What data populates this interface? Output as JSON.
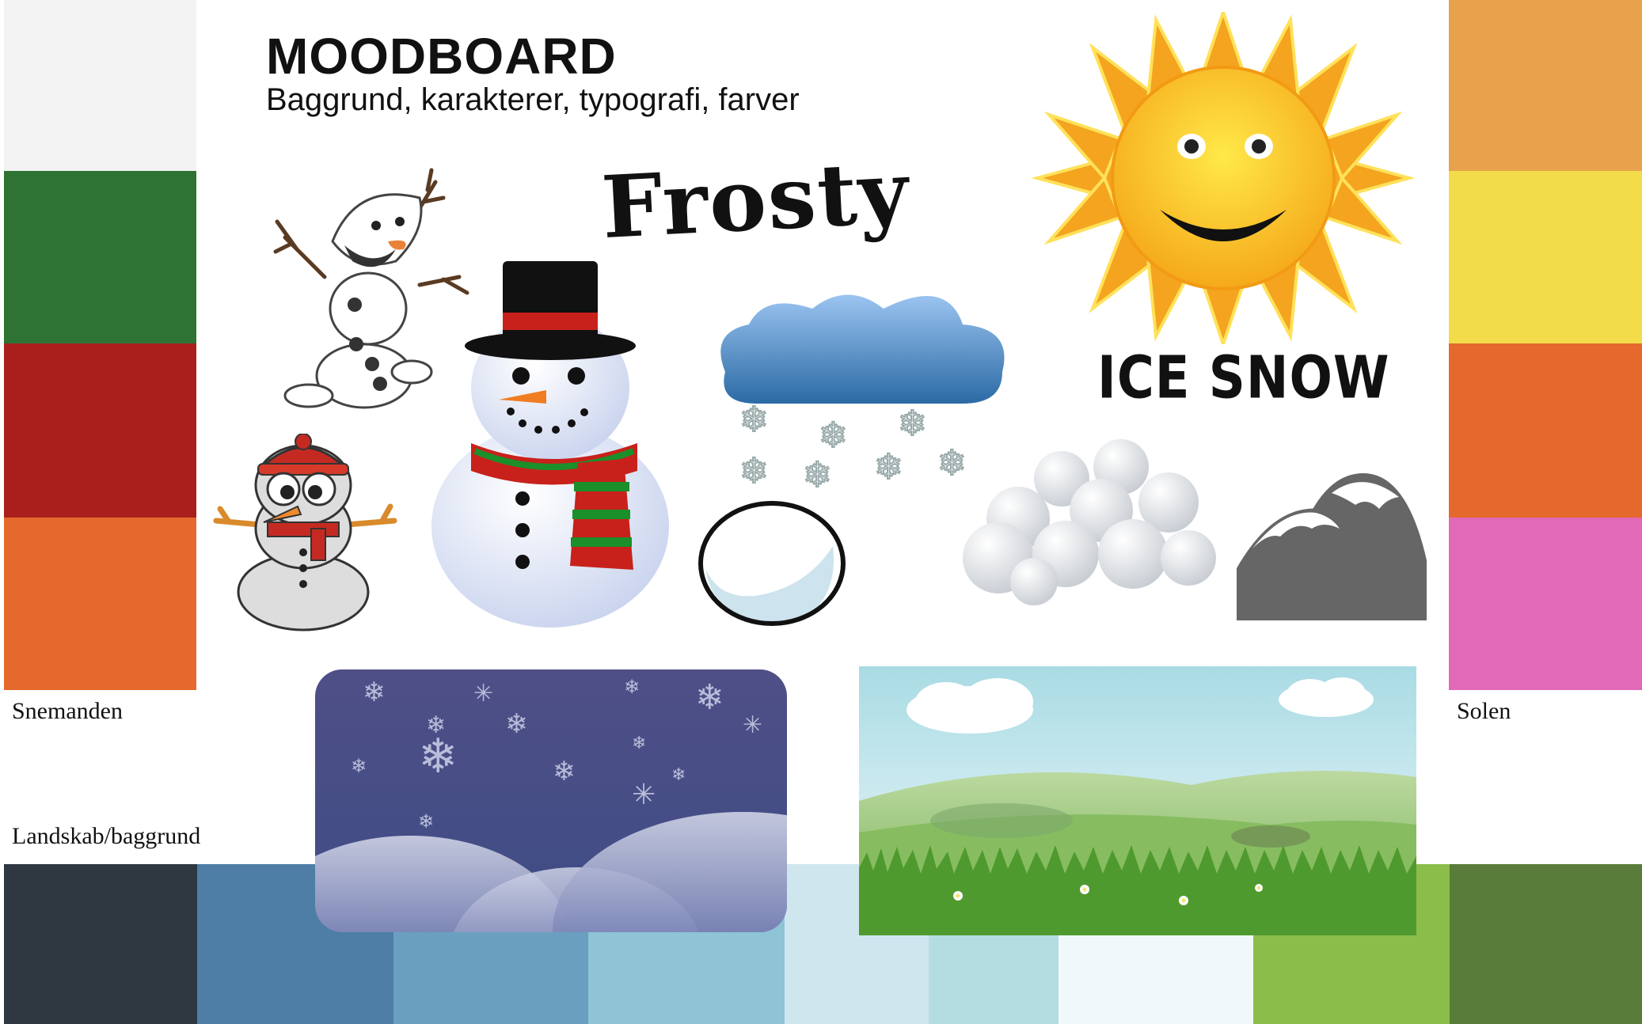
{
  "header": {
    "title": "MOODBOARD",
    "subtitle": "Baggrund, karakterer, typografi, farver"
  },
  "labels": {
    "snowman": "Snemanden",
    "sun": "Solen",
    "landscape": "Landskab/baggrund"
  },
  "typography_samples": {
    "frosty": "Frosty",
    "ice_snow": "ICE SNOW"
  },
  "palettes": {
    "snowman": [
      "#f3f3f3",
      "#2e7334",
      "#aa1f1b",
      "#e5692d"
    ],
    "sun": [
      "#e8a24c",
      "#f2dc4a",
      "#e5692d",
      "#e269b8"
    ],
    "landscape": [
      "#2f3740",
      "#4e7ea5",
      "#6a9fc0",
      "#8fc3d6",
      "#cfe6ef",
      "#b4dde1",
      "#f1f8f9",
      "#8bbd4a",
      "#5a7c3a"
    ]
  },
  "icons": [
    "olaf-snowman-icon",
    "cartoon-snowman-icon",
    "top-hat-snowman-icon",
    "snow-cloud-icon",
    "snowball-icon",
    "snowball-pile-icon",
    "snowy-mountain-icon",
    "smiling-sun-icon"
  ],
  "images": [
    "winter-night-background",
    "green-meadow-background"
  ]
}
